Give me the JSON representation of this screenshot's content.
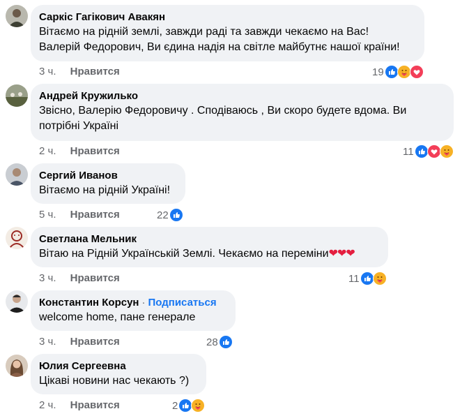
{
  "comments": [
    {
      "author": "Саркіс Гагікович Авакян",
      "lines": [
        "Вітаємо на рідній землі, завжди раді та завжди чекаємо на Вас!",
        "Валерій Федорович, Ви єдина надія на світле майбутнє нашої країни!"
      ],
      "time": "3 ч.",
      "like_label": "Нравится",
      "reaction_count": "19",
      "reactions": [
        "like-icon",
        "care-icon",
        "love-icon"
      ]
    },
    {
      "author": "Андрей Кружилько",
      "lines": [
        "Звісно, Валерію Федоровичу . Сподіваюсь , Ви скоро будете вдома. Ви",
        "потрібні Україні"
      ],
      "time": "2 ч.",
      "like_label": "Нравится",
      "reaction_count": "11",
      "reactions": [
        "like-icon",
        "love-icon",
        "care-icon"
      ]
    },
    {
      "author": "Сергий Иванов",
      "lines": [
        "Вітаємо на рідній Україні!"
      ],
      "time": "5 ч.",
      "like_label": "Нравится",
      "reaction_count": "22",
      "reactions": [
        "like-icon"
      ]
    },
    {
      "author": "Светлана Мельник",
      "lines": [
        "Вітаю на Рідній Українській Землі. Чекаємо на переміни"
      ],
      "emoji_suffix": "❤❤❤",
      "time": "3 ч.",
      "like_label": "Нравится",
      "reaction_count": "11",
      "reactions": [
        "like-icon",
        "care-icon"
      ]
    },
    {
      "author": "Константин Корсун",
      "separator": "·",
      "follow_label": "Подписаться",
      "lines": [
        "welcome home, пане генерале"
      ],
      "time": "3 ч.",
      "like_label": "Нравится",
      "reaction_count": "28",
      "reactions": [
        "like-icon"
      ]
    },
    {
      "author": "Юлия Сергеевна",
      "lines": [
        "Цікаві новини нас чекають ?)"
      ],
      "time": "2 ч.",
      "like_label": "Нравится",
      "reaction_count": "2",
      "reactions": [
        "like-icon",
        "care-icon"
      ]
    }
  ],
  "colors": {
    "bubble": "#f0f2f5",
    "secondary_text": "#65676b",
    "like_blue": "#1877f2",
    "love_red": "#f33e58",
    "care_yellow": "#f7b125"
  }
}
